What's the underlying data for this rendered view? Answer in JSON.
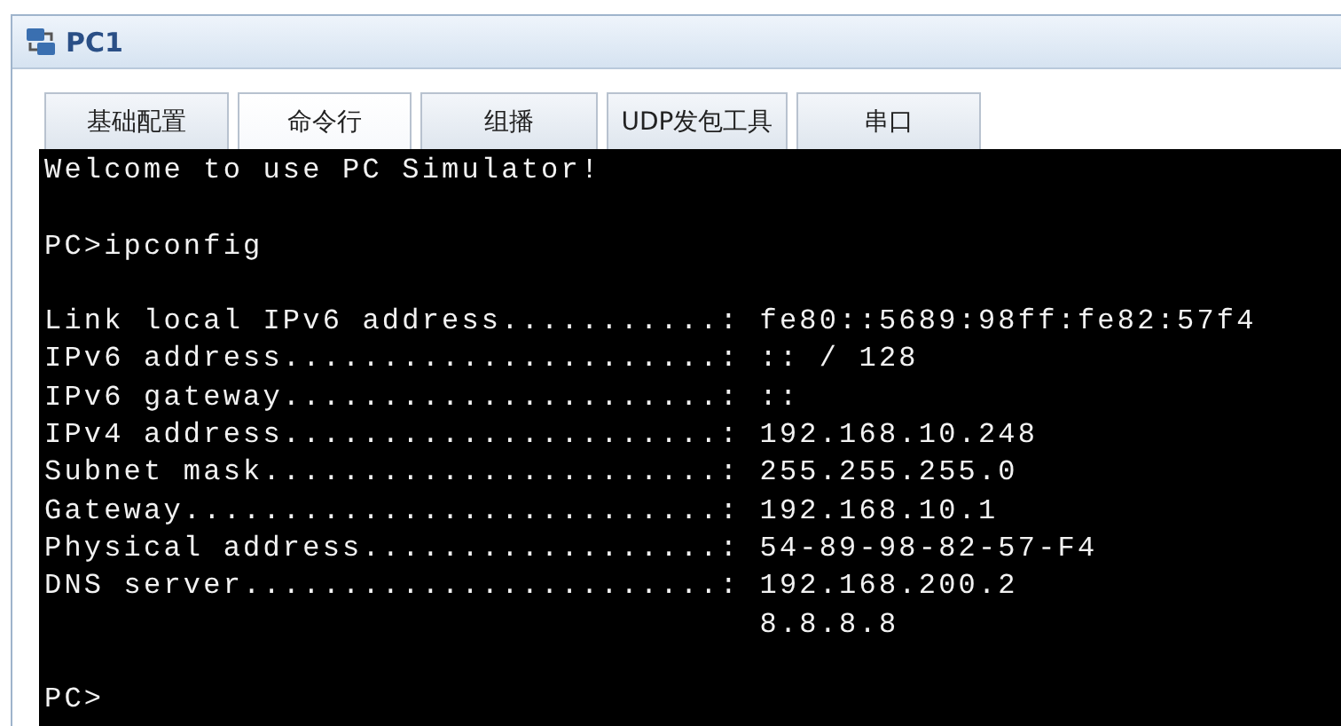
{
  "window": {
    "title": "PC1"
  },
  "tabs": [
    {
      "label": "基础配置",
      "selected": false
    },
    {
      "label": "命令行",
      "selected": true
    },
    {
      "label": "组播",
      "selected": false
    },
    {
      "label": "UDP发包工具",
      "selected": false
    },
    {
      "label": "串口",
      "selected": false
    }
  ],
  "terminal": {
    "lines": [
      {
        "kind": "text",
        "text": "Welcome to use PC Simulator!"
      },
      {
        "kind": "blank"
      },
      {
        "kind": "text",
        "text": "PC>ipconfig"
      },
      {
        "kind": "blank"
      },
      {
        "kind": "text",
        "text": "Link local IPv6 address...........: fe80::5689:98ff:fe82:57f4"
      },
      {
        "kind": "text",
        "text": "IPv6 address......................: :: / 128"
      },
      {
        "kind": "text",
        "text": "IPv6 gateway......................: ::"
      },
      {
        "kind": "text",
        "text": "IPv4 address......................: 192.168.10.248"
      },
      {
        "kind": "text",
        "text": "Subnet mask.......................: 255.255.255.0"
      },
      {
        "kind": "text",
        "text": "Gateway...........................: 192.168.10.1"
      },
      {
        "kind": "text",
        "text": "Physical address..................: 54-89-98-82-57-F4"
      },
      {
        "kind": "text",
        "text": "DNS server........................: 192.168.200.2"
      },
      {
        "kind": "text",
        "text": "                                    8.8.8.8"
      },
      {
        "kind": "blank"
      },
      {
        "kind": "text",
        "text": "PC>"
      }
    ]
  }
}
